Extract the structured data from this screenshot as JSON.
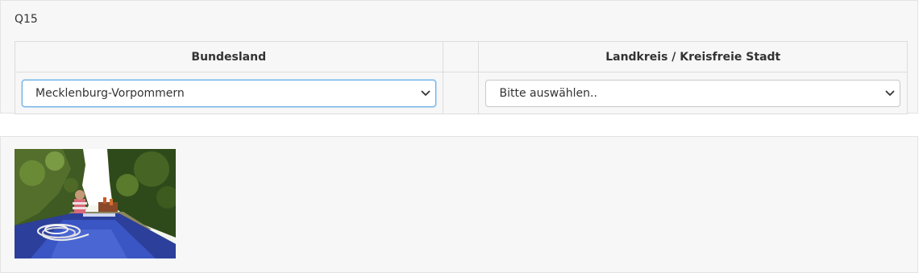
{
  "question": {
    "label": "Q15",
    "columns": [
      "Bundesland",
      "",
      "Landkreis / Kreisfreie Stadt"
    ],
    "bundesland_select": {
      "value": "Mecklenburg-Vorpommern"
    },
    "landkreis_select": {
      "value": "Bitte auswählen.."
    }
  },
  "media": {
    "image": {
      "subject": "narrowboat-canal-photo"
    }
  },
  "colors": {
    "panel_bg": "#f7f7f7",
    "focus_border": "#66afe9",
    "boat_blue": "#3a4fb0"
  },
  "icons": [
    "chevron-down-icon"
  ]
}
